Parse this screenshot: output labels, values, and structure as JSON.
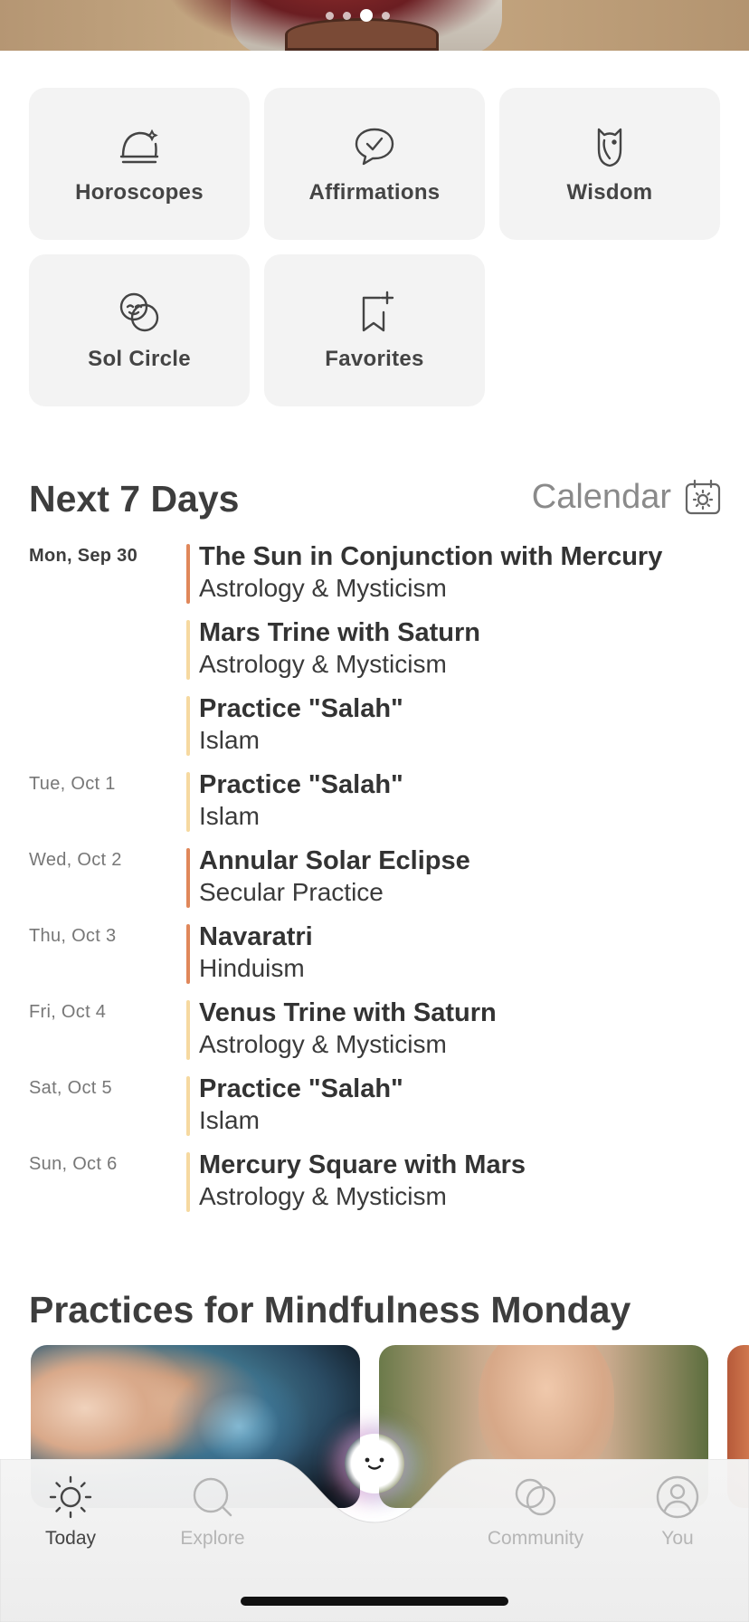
{
  "hero": {
    "carousel_pages": 4,
    "active_page": 3
  },
  "tiles": [
    {
      "label": "Horoscopes",
      "icon": "horoscope-icon"
    },
    {
      "label": "Affirmations",
      "icon": "affirmation-icon"
    },
    {
      "label": "Wisdom",
      "icon": "owl-icon"
    },
    {
      "label": "Sol Circle",
      "icon": "sol-circle-icon"
    },
    {
      "label": "Favorites",
      "icon": "bookmark-plus-icon"
    }
  ],
  "next7": {
    "title": "Next 7 Days",
    "calendar_label": "Calendar"
  },
  "events": [
    {
      "date": "Mon, Sep 30",
      "title": "The Sun in Conjunction with Mercury",
      "subtitle": "Astrology & Mysticism",
      "bar_color": "#e0875a"
    },
    {
      "date": "",
      "title": "Mars Trine with Saturn",
      "subtitle": "Astrology & Mysticism",
      "bar_color": "#f6d9a0"
    },
    {
      "date": "",
      "title": "Practice \"Salah\"",
      "subtitle": "Islam",
      "bar_color": "#f6d9a0"
    },
    {
      "date": "Tue, Oct 1",
      "title": "Practice \"Salah\"",
      "subtitle": "Islam",
      "bar_color": "#f6d9a0"
    },
    {
      "date": "Wed, Oct 2",
      "title": "Annular Solar Eclipse",
      "subtitle": "Secular Practice",
      "bar_color": "#e0875a"
    },
    {
      "date": "Thu, Oct 3",
      "title": "Navaratri",
      "subtitle": "Hinduism",
      "bar_color": "#e0875a"
    },
    {
      "date": "Fri, Oct 4",
      "title": "Venus Trine with Saturn",
      "subtitle": "Astrology & Mysticism",
      "bar_color": "#f6d9a0"
    },
    {
      "date": "Sat, Oct 5",
      "title": "Practice \"Salah\"",
      "subtitle": "Islam",
      "bar_color": "#f6d9a0"
    },
    {
      "date": "Sun, Oct 6",
      "title": "Mercury Square with Mars",
      "subtitle": "Astrology & Mysticism",
      "bar_color": "#f6d9a0"
    }
  ],
  "practices": {
    "title": "Practices for Mindfulness Monday"
  },
  "tabbar": {
    "tabs": [
      {
        "label": "Today",
        "icon": "sun-icon",
        "active": true
      },
      {
        "label": "Explore",
        "icon": "search-icon",
        "active": false
      },
      {
        "label": "Community",
        "icon": "overlap-circles-icon",
        "active": false
      },
      {
        "label": "You",
        "icon": "person-icon",
        "active": false
      }
    ],
    "center_icon": "smiley-orb-icon"
  }
}
